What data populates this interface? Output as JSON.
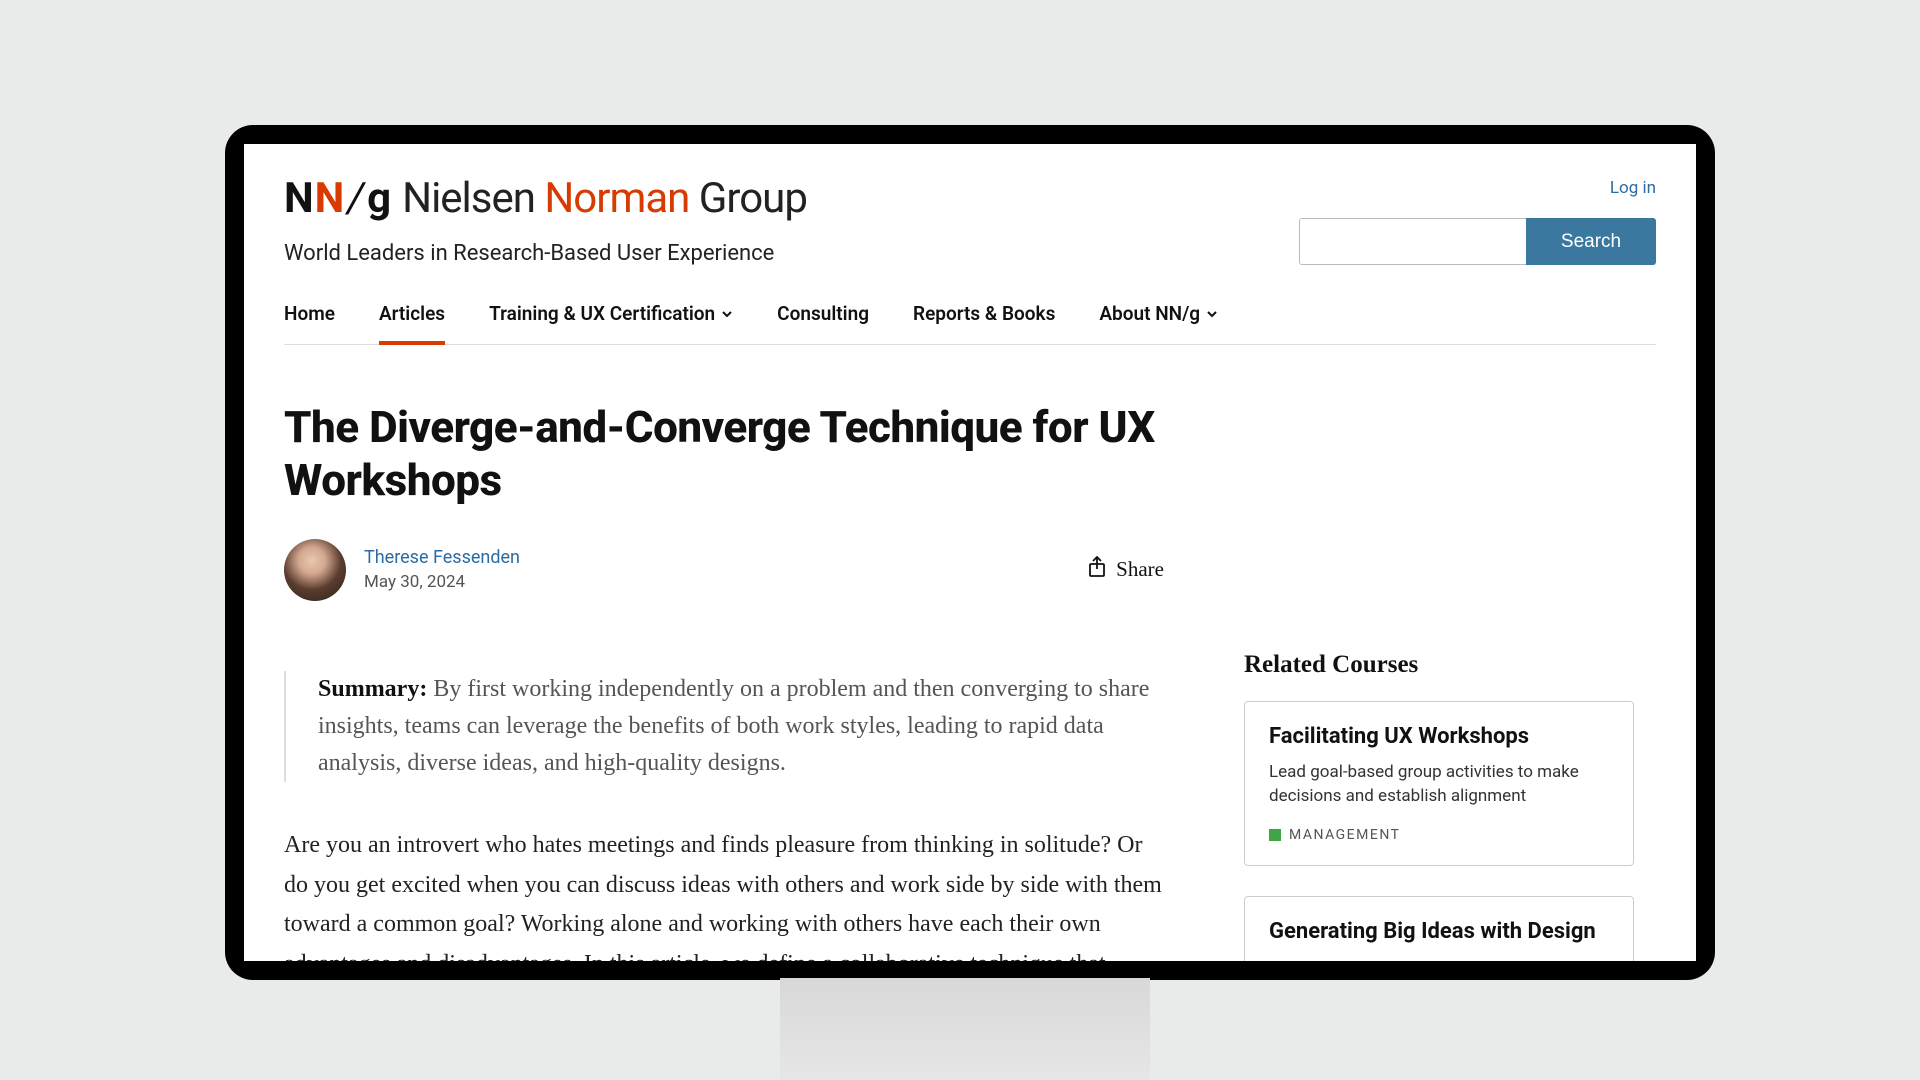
{
  "header": {
    "logo": {
      "n1": "N",
      "n2": "N",
      "slash": "/",
      "g": "g"
    },
    "brand_text": {
      "p1": "Nielsen ",
      "p2": "Norman",
      "p3": " Group"
    },
    "tagline": "World Leaders in Research-Based User Experience",
    "login_label": "Log in",
    "search_button": "Search"
  },
  "nav": {
    "items": [
      {
        "label": "Home",
        "has_dropdown": false,
        "active": false
      },
      {
        "label": "Articles",
        "has_dropdown": false,
        "active": true
      },
      {
        "label": "Training & UX Certification",
        "has_dropdown": true,
        "active": false
      },
      {
        "label": "Consulting",
        "has_dropdown": false,
        "active": false
      },
      {
        "label": "Reports & Books",
        "has_dropdown": false,
        "active": false
      },
      {
        "label": "About NN/g",
        "has_dropdown": true,
        "active": false
      }
    ]
  },
  "article": {
    "title": "The Diverge-and-Converge Technique for UX Workshops",
    "author": "Therese Fessenden",
    "date": "May 30, 2024",
    "share_label": "Share",
    "summary_label": "Summary:",
    "summary": "By first working independently on a problem and then converging to share insights, teams can leverage the benefits of both work styles, leading to rapid data analysis, diverse ideas, and high-quality designs.",
    "body_p1": "Are you an introvert who hates meetings and finds pleasure from thinking in solitude? Or do you get excited when you can discuss ideas with others and work side by side with them toward a common goal? Working alone and working with others have each their own advantages and disadvantages. In this article, we define a collaborative technique that combines the two in order"
  },
  "sidebar": {
    "heading": "Related Courses",
    "courses": [
      {
        "title": "Facilitating UX Workshops",
        "description": "Lead goal-based group activities to make decisions and establish alignment",
        "tag": "MANAGEMENT",
        "tag_color": "#3fa648"
      },
      {
        "title": "Generating Big Ideas with Design",
        "description": "",
        "tag": "",
        "tag_color": ""
      }
    ]
  }
}
